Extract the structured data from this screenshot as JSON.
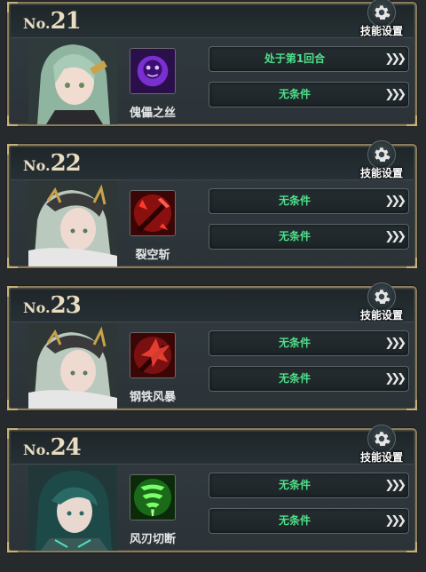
{
  "settings_label": "技能设置",
  "no_prefix": "No.",
  "cards": [
    {
      "number": "21",
      "skill_name": "傀儡之丝",
      "conditions": [
        "处于第1回合",
        "无条件"
      ]
    },
    {
      "number": "22",
      "skill_name": "裂空斩",
      "conditions": [
        "无条件",
        "无条件"
      ]
    },
    {
      "number": "23",
      "skill_name": "钢铁风暴",
      "conditions": [
        "无条件",
        "无条件"
      ]
    },
    {
      "number": "24",
      "skill_name": "风刃切断",
      "conditions": [
        "无条件",
        "无条件"
      ]
    }
  ],
  "colors": {
    "condition_text": "#4fe08a",
    "border_gold": "#8a7d5e"
  },
  "icons": [
    "gear-icon",
    "chevron-right-icon",
    "puppet-skill-icon",
    "sword-skill-icon",
    "storm-skill-icon",
    "wind-skill-icon"
  ]
}
